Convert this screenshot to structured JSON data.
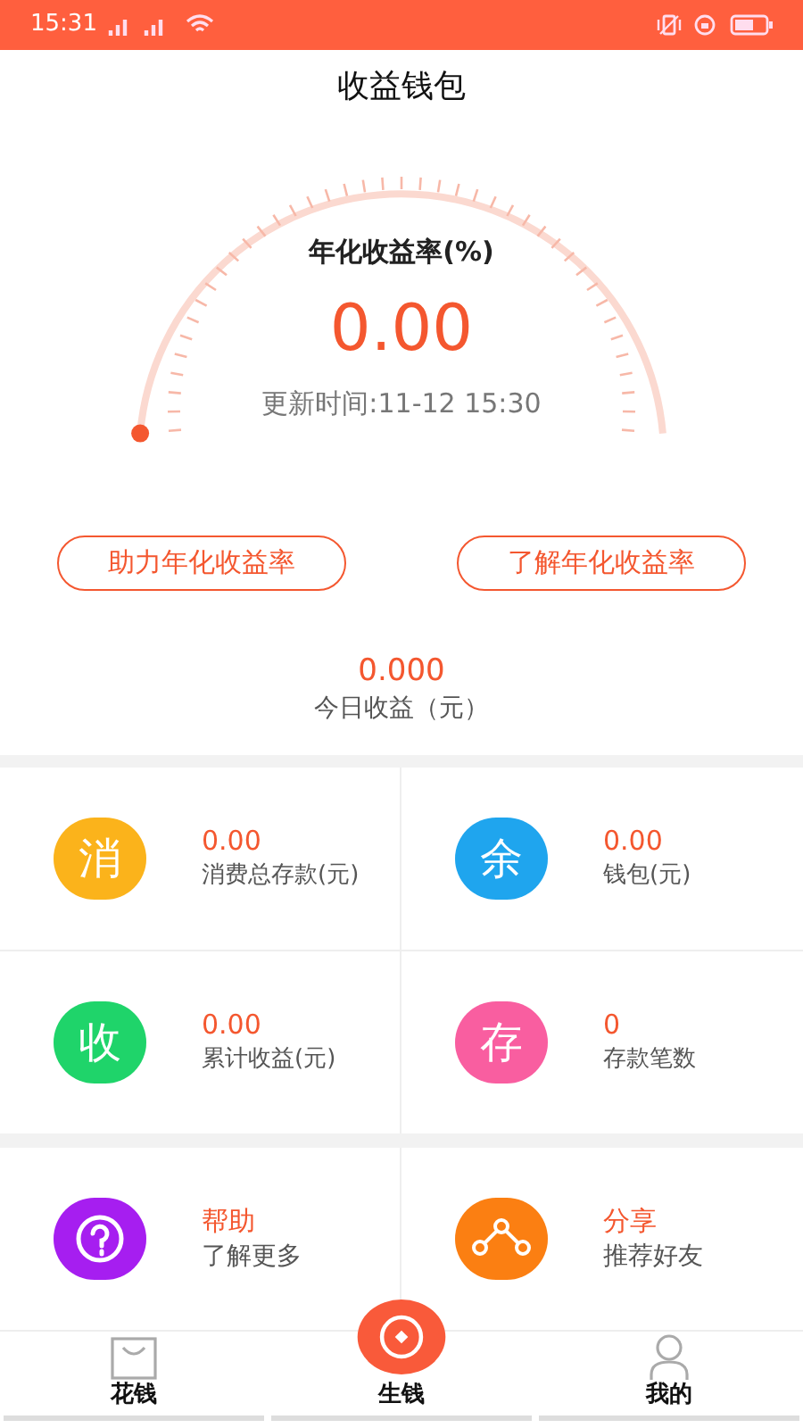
{
  "status_bar": {
    "time": "15:31"
  },
  "title": "收益钱包",
  "gauge": {
    "label": "年化收益率(%)",
    "value": "0.00",
    "updated": "更新时间:11-12 15:30",
    "level": 0
  },
  "actions": [
    "助力年化收益率",
    "了解年化收益率"
  ],
  "today": {
    "value": "0.000",
    "label": "今日收益（元）"
  },
  "stats": [
    {
      "kind": "stat",
      "badge": "消",
      "color": "#fbb31b",
      "value": "0.00",
      "label": "消费总存款(元)"
    },
    {
      "kind": "stat",
      "badge": "余",
      "color": "#1fa5ee",
      "value": "0.00",
      "label": "钱包(元)"
    },
    {
      "kind": "stat",
      "badge": "收",
      "color": "#1fd46a",
      "value": "0.00",
      "label": "累计收益(元)"
    },
    {
      "kind": "stat",
      "badge": "存",
      "color": "#f95ea0",
      "value": "0",
      "label": "存款笔数"
    }
  ],
  "links": [
    {
      "kind": "help",
      "color": "#a61ef0",
      "title": "帮助",
      "subtitle": "了解更多"
    },
    {
      "kind": "share",
      "color": "#fb7f12",
      "title": "分享",
      "subtitle": "推荐好友"
    }
  ],
  "tabs": [
    {
      "kind": "bag",
      "label": "花钱"
    },
    {
      "kind": "coin",
      "label": "生钱"
    },
    {
      "kind": "person",
      "label": "我的"
    }
  ]
}
